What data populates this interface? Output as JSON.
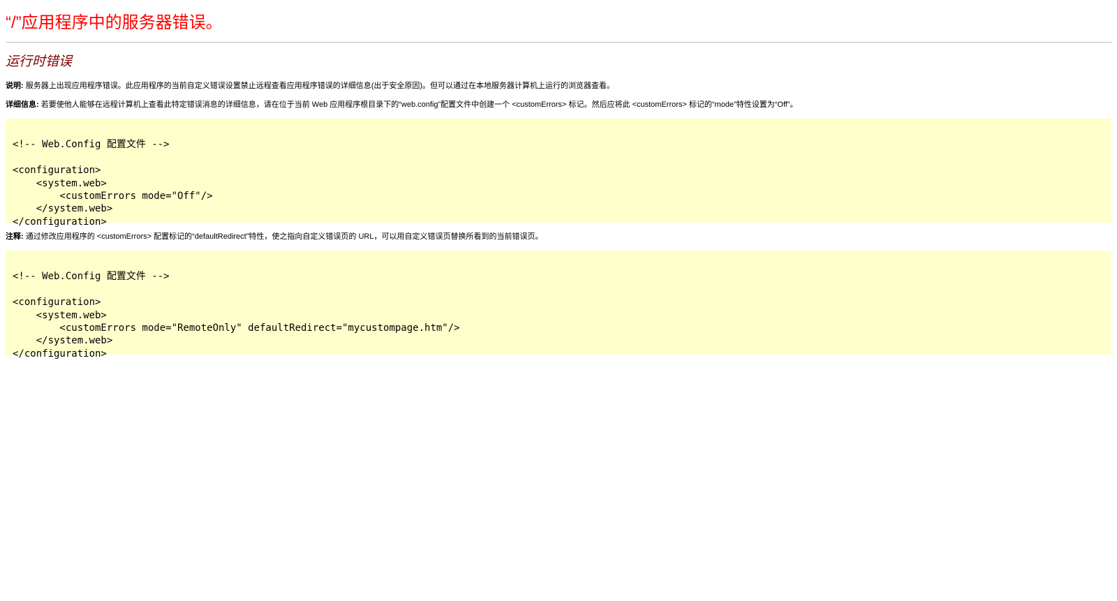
{
  "header": {
    "title": "“/”应用程序中的服务器错误。"
  },
  "section": {
    "title": "运行时错误"
  },
  "description": {
    "label": "说明:",
    "text": " 服务器上出现应用程序错误。此应用程序的当前自定义错误设置禁止远程查看应用程序错误的详细信息(出于安全原因)。但可以通过在本地服务器计算机上运行的浏览器查看。"
  },
  "details": {
    "label": "详细信息:",
    "text": " 若要使他人能够在远程计算机上查看此特定错误消息的详细信息，请在位于当前 Web 应用程序根目录下的“web.config”配置文件中创建一个 <customErrors> 标记。然后应将此 <customErrors> 标记的“mode”特性设置为“Off”。"
  },
  "code1": "\n<!-- Web.Config 配置文件 -->\n\n<configuration>\n    <system.web>\n        <customErrors mode=\"Off\"/>\n    </system.web>\n</configuration>",
  "notes": {
    "label": "注释:",
    "text": " 通过修改应用程序的 <customErrors> 配置标记的“defaultRedirect”特性，使之指向自定义错误页的 URL，可以用自定义错误页替换所看到的当前错误页。"
  },
  "code2": "\n<!-- Web.Config 配置文件 -->\n\n<configuration>\n    <system.web>\n        <customErrors mode=\"RemoteOnly\" defaultRedirect=\"mycustompage.htm\"/>\n    </system.web>\n</configuration>",
  "colors": {
    "title": "#ff0000",
    "section_title": "#800000",
    "code_background": "#ffffcc"
  }
}
